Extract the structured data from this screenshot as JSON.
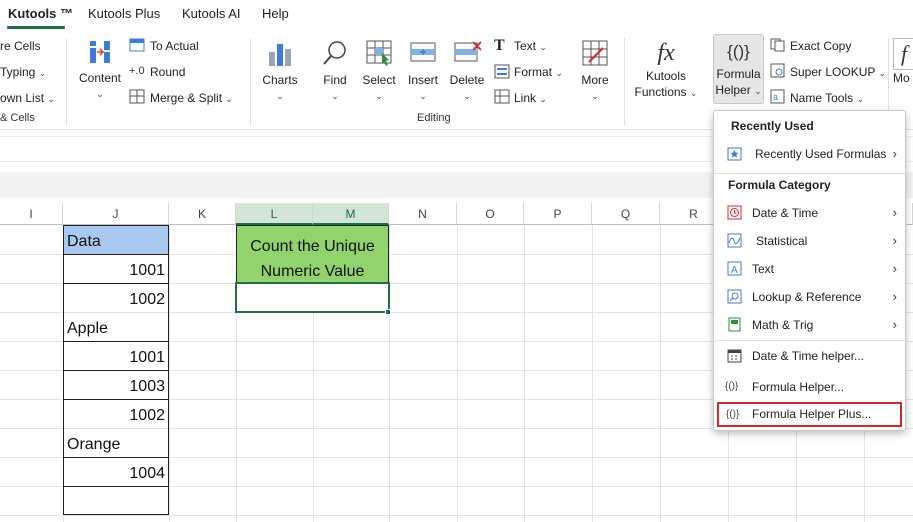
{
  "tabs": [
    {
      "label": "Kutools ™"
    },
    {
      "label": "Kutools Plus"
    },
    {
      "label": "Kutools AI"
    },
    {
      "label": "Help"
    }
  ],
  "ribbon": {
    "left_items": [
      "re Cells",
      "Typing",
      "own List",
      "& Cells"
    ],
    "content_label": "Content",
    "to_actual": "To Actual",
    "round": "Round",
    "merge_split": "Merge & Split",
    "charts": "Charts",
    "find": "Find",
    "select": "Select",
    "insert": "Insert",
    "delete": "Delete",
    "text": "Text",
    "format": "Format",
    "link": "Link",
    "more": "More",
    "editing_group": "Editing",
    "kutools_functions_1": "Kutools",
    "kutools_functions_2": "Functions",
    "formula_helper_1": "Formula",
    "formula_helper_2": "Helper",
    "exact_copy": "Exact Copy",
    "super_lookup": "Super LOOKUP",
    "name_tools": "Name Tools",
    "more_right": "Mo"
  },
  "columns": [
    "I",
    "J",
    "K",
    "L",
    "M",
    "N",
    "O",
    "P",
    "Q",
    "R"
  ],
  "cells": {
    "j_data_header": "Data",
    "j1": "1001",
    "j2": "1002",
    "j3": "Apple",
    "j4": "1001",
    "j5": "1003",
    "j6": "1002",
    "j7": "Orange",
    "j8": "1004",
    "lm_header_1": "Count the Unique",
    "lm_header_2": "Numeric Value"
  },
  "menu": {
    "recently_used_header": "Recently Used",
    "recently_used_formulas": "Recently Used Formulas",
    "formula_category_header": "Formula Category",
    "date_time": "Date & Time",
    "statistical": "Statistical",
    "text": "Text",
    "lookup_reference": "Lookup & Reference",
    "math_trig": "Math & Trig",
    "date_time_helper": "Date & Time helper...",
    "formula_helper": "Formula Helper...",
    "formula_helper_plus": "Formula Helper Plus..."
  },
  "colors": {
    "accent_green": "#1e7145",
    "header_fill_blue": "#a9c9ef",
    "header_fill_green": "#92d36e",
    "highlight_red": "#d9262a"
  }
}
